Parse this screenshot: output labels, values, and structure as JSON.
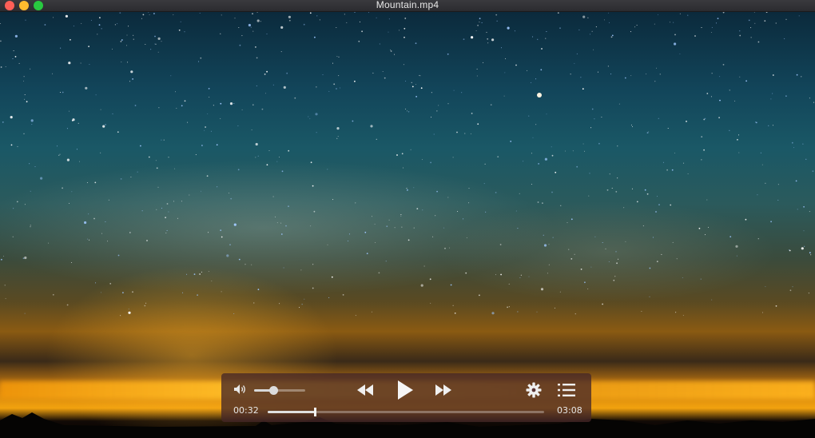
{
  "window": {
    "title": "Mountain.mp4"
  },
  "player": {
    "volume": 0.37,
    "current_time": "00:32",
    "duration": "03:08",
    "progress": 0.17
  },
  "icons": {
    "volume": "speaker-icon",
    "rewind": "rewind-icon",
    "play": "play-icon",
    "forward": "fast-forward-icon",
    "settings": "gear-icon",
    "playlist": "list-icon"
  },
  "colors": {
    "close": "#fe5f57",
    "minimize": "#febc2e",
    "maximize": "#28c840"
  }
}
